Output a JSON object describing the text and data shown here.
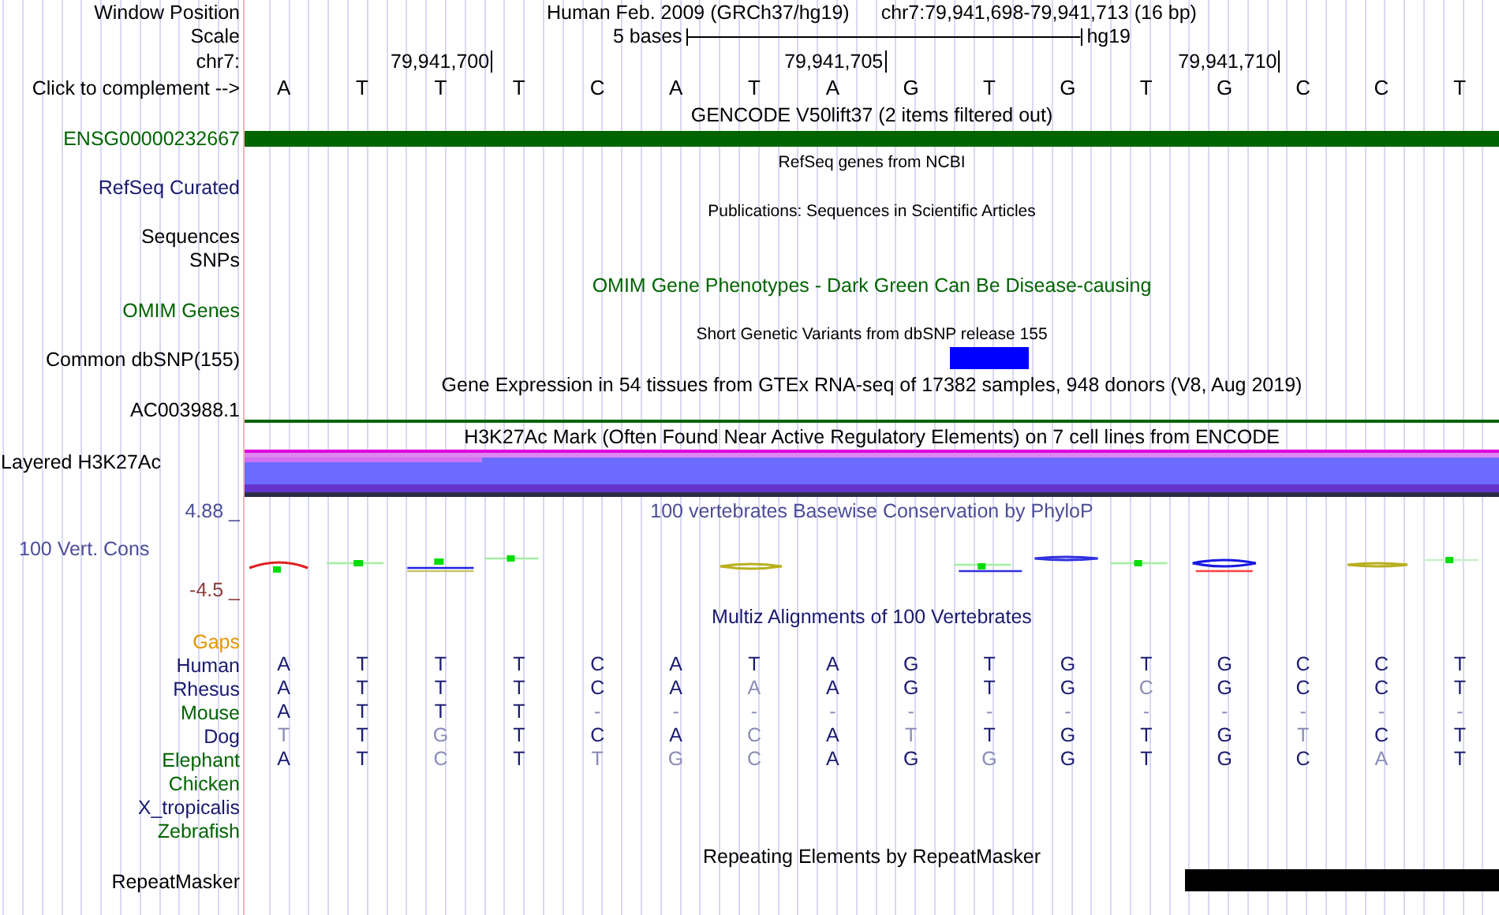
{
  "rows": [
    {
      "kind": "title",
      "label": {
        "text": "Window Position"
      },
      "texts": [
        "Human Feb. 2009 (GRCh37/hg19)",
        "chr7:79,941,698-79,941,713 (16 bp)"
      ]
    },
    {
      "kind": "scale",
      "label": {
        "text": "Scale"
      },
      "text": "5 bases",
      "assembly": "hg19"
    },
    {
      "kind": "sequence",
      "position_label": "chr7:",
      "label": {
        "text": "Click to complement -->"
      },
      "bases": [
        {
          "base": "A"
        },
        {
          "base": "T"
        },
        {
          "base": "T",
          "coordinate": "79,941,700"
        },
        {
          "base": "T"
        },
        {
          "base": "C"
        },
        {
          "base": "A"
        },
        {
          "base": "T"
        },
        {
          "base": "A",
          "coordinate": "79,941,705"
        },
        {
          "base": "G"
        },
        {
          "base": "T"
        },
        {
          "base": "G"
        },
        {
          "base": "T"
        },
        {
          "base": "G",
          "coordinate": "79,941,710"
        },
        {
          "base": "C"
        },
        {
          "base": "C"
        },
        {
          "base": "T"
        }
      ]
    },
    {
      "kind": "track_title",
      "text": "GENCODE V50lift37 (2 items filtered out)",
      "color": "#000000"
    },
    {
      "kind": "bar",
      "label": {
        "text": "ENSG00000232667",
        "color": "#006400"
      },
      "color": "#006400"
    },
    {
      "kind": "note",
      "text": "RefSeq genes from NCBI"
    },
    {
      "kind": "empty",
      "label": {
        "text": "RefSeq Curated",
        "color": "#191970"
      }
    },
    {
      "kind": "note",
      "text": "Publications: Sequences in Scientific Articles"
    },
    {
      "kind": "empty",
      "label": {
        "text": "Sequences",
        "color": "#000000"
      }
    },
    {
      "kind": "empty",
      "label": {
        "text": "SNPs",
        "color": "#000000"
      }
    },
    {
      "kind": "track_title",
      "text": "OMIM Gene Phenotypes - Dark Green Can Be Disease-causing",
      "color": "#006400"
    },
    {
      "kind": "empty",
      "label": {
        "text": "OMIM Genes",
        "color": "#006400"
      }
    },
    {
      "kind": "note",
      "text": "Short Genetic Variants from dbSNP release 155"
    },
    {
      "kind": "feature",
      "label": {
        "text": "Common dbSNP(155)",
        "color": "#000000"
      },
      "color": "#0000ff",
      "covered": [
        false,
        false,
        false,
        false,
        false,
        false,
        false,
        false,
        false,
        true,
        false,
        false,
        false,
        false,
        false,
        false
      ]
    },
    {
      "kind": "track_title",
      "text": "Gene Expression in 54 tissues from GTEx RNA-seq of 17382 samples, 948 donors (V8, Aug 2019)",
      "color": "#000000"
    },
    {
      "kind": "line",
      "label": {
        "text": "AC003988.1",
        "color": "#000000"
      },
      "color": "#006400"
    },
    {
      "kind": "track_title",
      "text": "H3K27Ac Mark (Often Found Near Active Regulatory Elements) on 7 cell lines from ENCODE",
      "color": "#000000"
    },
    {
      "kind": "layered",
      "label": {
        "text": "Layered H3K27Ac",
        "color": "#000000"
      }
    },
    {
      "kind": "axis_top",
      "upper": "4.88 _",
      "text": "100 vertebrates Basewise Conservation by PhyloP",
      "color": "#4d4d99"
    },
    {
      "kind": "wiggle",
      "label": {
        "text": "100 Vert. Cons",
        "color": "#4d4d99"
      }
    },
    {
      "kind": "axis_bottom",
      "lower": "-4.5 _",
      "color": "#8b3a3a"
    },
    {
      "kind": "track_title",
      "text": "Multiz Alignments of 100 Vertebrates",
      "color": "#191970"
    },
    {
      "kind": "empty",
      "label": {
        "text": "Gaps",
        "color": "#e69500"
      }
    },
    {
      "kind": "alignment",
      "label": {
        "text": "Human",
        "color": "#191970"
      },
      "bases": [
        {
          "base": "A",
          "match": true
        },
        {
          "base": "T",
          "match": true
        },
        {
          "base": "T",
          "match": true
        },
        {
          "base": "T",
          "match": true
        },
        {
          "base": "C",
          "match": true
        },
        {
          "base": "A",
          "match": true
        },
        {
          "base": "T",
          "match": true
        },
        {
          "base": "A",
          "match": true
        },
        {
          "base": "G",
          "match": true
        },
        {
          "base": "T",
          "match": true
        },
        {
          "base": "G",
          "match": true
        },
        {
          "base": "T",
          "match": true
        },
        {
          "base": "G",
          "match": true
        },
        {
          "base": "C",
          "match": true
        },
        {
          "base": "C",
          "match": true
        },
        {
          "base": "T",
          "match": true
        }
      ]
    },
    {
      "kind": "alignment",
      "label": {
        "text": "Rhesus",
        "color": "#191970"
      },
      "bases": [
        {
          "base": "A",
          "match": true
        },
        {
          "base": "T",
          "match": true
        },
        {
          "base": "T",
          "match": true
        },
        {
          "base": "T",
          "match": true
        },
        {
          "base": "C",
          "match": true
        },
        {
          "base": "A",
          "match": true
        },
        {
          "base": "A",
          "match": false
        },
        {
          "base": "A",
          "match": true
        },
        {
          "base": "G",
          "match": true
        },
        {
          "base": "T",
          "match": true
        },
        {
          "base": "G",
          "match": true
        },
        {
          "base": "C",
          "match": false
        },
        {
          "base": "G",
          "match": true
        },
        {
          "base": "C",
          "match": true
        },
        {
          "base": "C",
          "match": true
        },
        {
          "base": "T",
          "match": true
        }
      ]
    },
    {
      "kind": "alignment",
      "label": {
        "text": "Mouse",
        "color": "#006400"
      },
      "bases": [
        {
          "base": "A",
          "match": true
        },
        {
          "base": "T",
          "match": true
        },
        {
          "base": "T",
          "match": true
        },
        {
          "base": "T",
          "match": true
        },
        {
          "base": "-",
          "match": false
        },
        {
          "base": "-",
          "match": false
        },
        {
          "base": "-",
          "match": false
        },
        {
          "base": "-",
          "match": false
        },
        {
          "base": "-",
          "match": false
        },
        {
          "base": "-",
          "match": false
        },
        {
          "base": "-",
          "match": false
        },
        {
          "base": "-",
          "match": false
        },
        {
          "base": "-",
          "match": false
        },
        {
          "base": "-",
          "match": false
        },
        {
          "base": "-",
          "match": false
        },
        {
          "base": "-",
          "match": false
        }
      ]
    },
    {
      "kind": "alignment",
      "label": {
        "text": "Dog",
        "color": "#191970"
      },
      "bases": [
        {
          "base": "T",
          "match": false
        },
        {
          "base": "T",
          "match": true
        },
        {
          "base": "G",
          "match": false
        },
        {
          "base": "T",
          "match": true
        },
        {
          "base": "C",
          "match": true
        },
        {
          "base": "A",
          "match": true
        },
        {
          "base": "C",
          "match": false
        },
        {
          "base": "A",
          "match": true
        },
        {
          "base": "T",
          "match": false
        },
        {
          "base": "T",
          "match": true
        },
        {
          "base": "G",
          "match": true
        },
        {
          "base": "T",
          "match": true
        },
        {
          "base": "G",
          "match": true
        },
        {
          "base": "T",
          "match": false
        },
        {
          "base": "C",
          "match": true
        },
        {
          "base": "T",
          "match": true
        }
      ]
    },
    {
      "kind": "alignment",
      "label": {
        "text": "Elephant",
        "color": "#006400"
      },
      "bases": [
        {
          "base": "A",
          "match": true
        },
        {
          "base": "T",
          "match": true
        },
        {
          "base": "C",
          "match": false
        },
        {
          "base": "T",
          "match": true
        },
        {
          "base": "T",
          "match": false
        },
        {
          "base": "G",
          "match": false
        },
        {
          "base": "C",
          "match": false
        },
        {
          "base": "A",
          "match": true
        },
        {
          "base": "G",
          "match": true
        },
        {
          "base": "G",
          "match": false
        },
        {
          "base": "G",
          "match": true
        },
        {
          "base": "T",
          "match": true
        },
        {
          "base": "G",
          "match": true
        },
        {
          "base": "C",
          "match": true
        },
        {
          "base": "A",
          "match": false
        },
        {
          "base": "T",
          "match": true
        }
      ]
    },
    {
      "kind": "alignment",
      "label": {
        "text": "Chicken",
        "color": "#006400"
      }
    },
    {
      "kind": "alignment",
      "label": {
        "text": "X_tropicalis",
        "color": "#191970"
      }
    },
    {
      "kind": "alignment",
      "label": {
        "text": "Zebrafish",
        "color": "#006400"
      }
    },
    {
      "kind": "track_title",
      "text": "Repeating Elements by RepeatMasker",
      "color": "#000000"
    },
    {
      "kind": "feature",
      "label": {
        "text": "RepeatMasker",
        "color": "#000000"
      },
      "color": "#000000",
      "covered": [
        false,
        false,
        false,
        false,
        false,
        false,
        false,
        false,
        false,
        false,
        false,
        false,
        true,
        true,
        true,
        true
      ]
    }
  ]
}
